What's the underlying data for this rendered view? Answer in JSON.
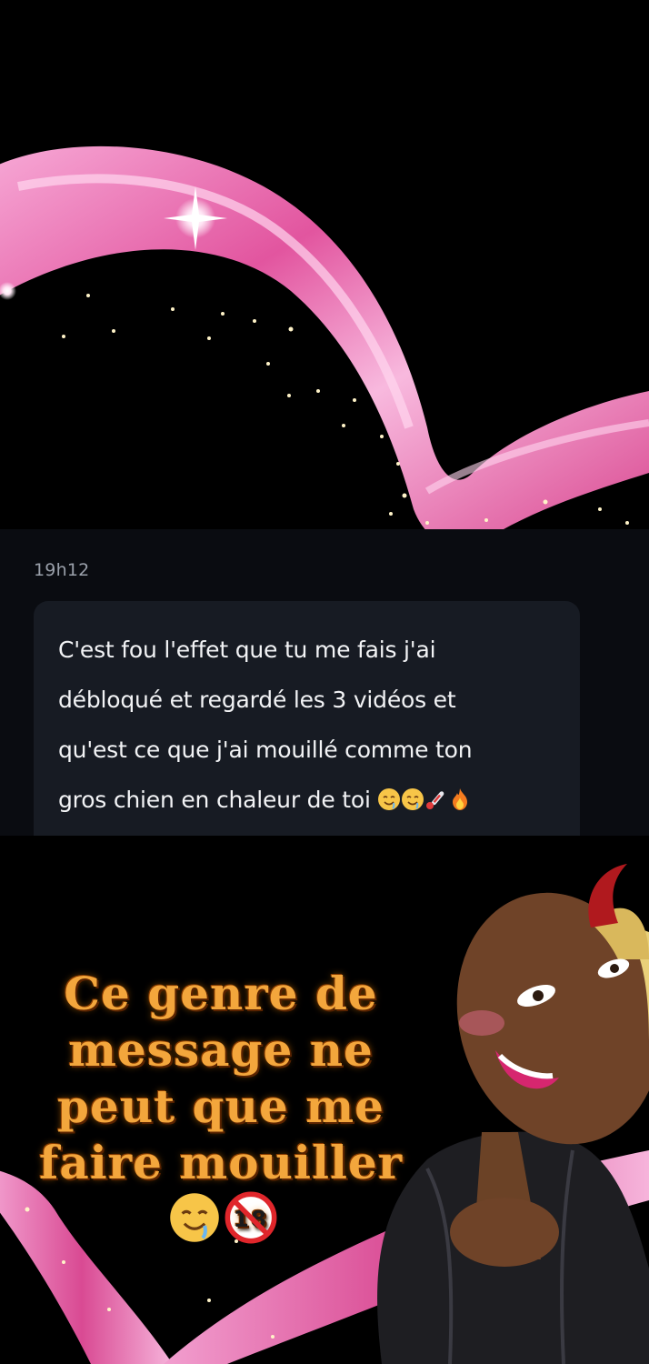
{
  "message": {
    "timestamp": "19h12",
    "text": "C'est fou l'effet que tu me fais j'ai\ndébloqué et regardé les 3 vidéos et\nqu'est ce que j'ai mouillé comme ton\ngros chien en chaleur de toi ",
    "emojis": [
      "drooling-face-emoji",
      "drooling-face-emoji",
      "thermometer-emoji",
      "fire-emoji"
    ]
  },
  "sticker": {
    "caption": "Ce genre de message ne peut que me faire mouiller",
    "caption_emojis": [
      "drooling-face-emoji",
      "no-under-18-emoji"
    ]
  },
  "colors": {
    "background": "#000000",
    "chat_panel": "#0a0c11",
    "bubble": "#171b23",
    "bubble_text": "#f2f3f5",
    "timestamp": "#9aa0aa",
    "caption": "#f3a63c",
    "heart_pink": "#f07ac0"
  }
}
